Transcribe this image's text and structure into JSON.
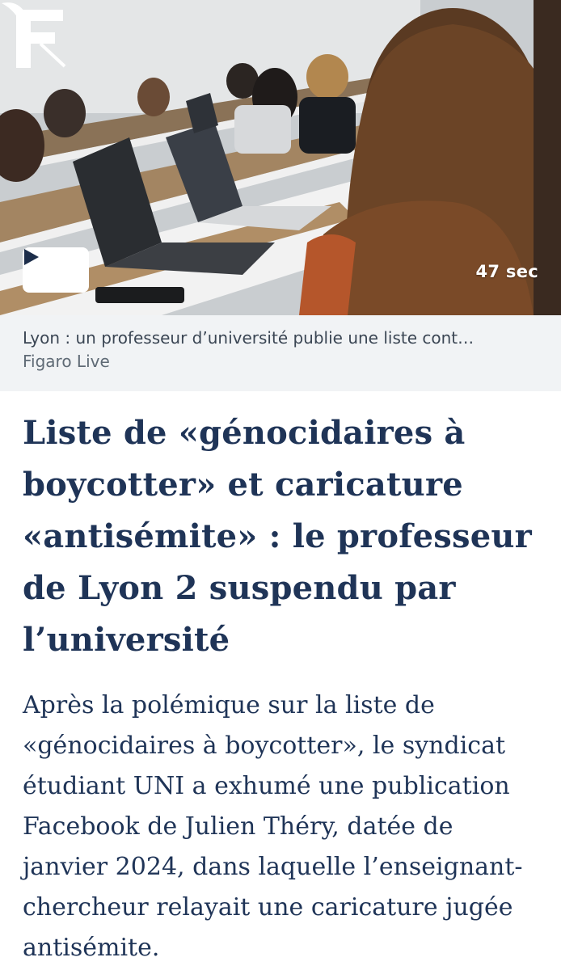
{
  "video": {
    "duration": "47 sec",
    "play_icon": "play-icon",
    "logo_letter": "F",
    "caption_title": "Lyon : un professeur d’université publie une liste cont…",
    "caption_source": "Figaro Live"
  },
  "article": {
    "headline": "Liste de «génocidaires à boycotter» et caricature «antisémite» : le professeur de Lyon 2 suspendu par l’université",
    "lede": "Après la polémique sur la liste de «génocidaires à boycotter», le syndicat étudiant UNI a exhumé une publication Facebook de Julien Théry, datée de janvier 2024, dans laquelle l’enseignant-chercheur relayait une caricature jugée antisémite."
  },
  "colors": {
    "headline": "#1f3457",
    "caption_background": "#f1f3f5"
  }
}
